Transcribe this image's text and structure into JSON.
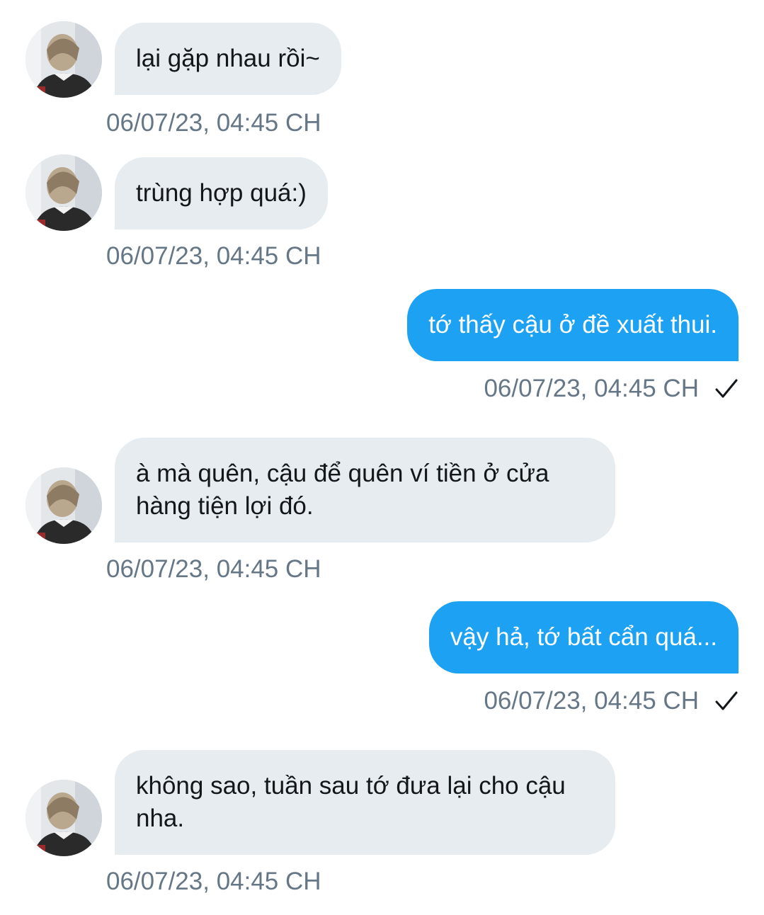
{
  "messages": [
    {
      "direction": "in",
      "text": "lại gặp nhau rồi~",
      "time": "06/07/23, 04:45 CH"
    },
    {
      "direction": "in",
      "text": "trùng hợp quá:)",
      "time": "06/07/23, 04:45 CH"
    },
    {
      "direction": "out",
      "text": "tớ thấy cậu ở đề xuất thui.",
      "time": "06/07/23, 04:45 CH",
      "status_icon": "checkmark-icon"
    },
    {
      "direction": "in",
      "text": "à mà quên, cậu để quên ví tiền ở cửa hàng tiện lợi đó.",
      "time": "06/07/23, 04:45 CH"
    },
    {
      "direction": "out",
      "text": "vậy hả, tớ bất cẩn quá...",
      "time": "06/07/23, 04:45 CH",
      "status_icon": "checkmark-icon"
    },
    {
      "direction": "in",
      "text": "không sao, tuần sau tớ đưa lại cho cậu nha.",
      "time": "06/07/23, 04:45 CH"
    }
  ],
  "colors": {
    "incoming_bubble": "#e6ecf0",
    "outgoing_bubble": "#1da1f2",
    "timestamp": "#657786",
    "incoming_text": "#14171a",
    "outgoing_text": "#ffffff"
  }
}
